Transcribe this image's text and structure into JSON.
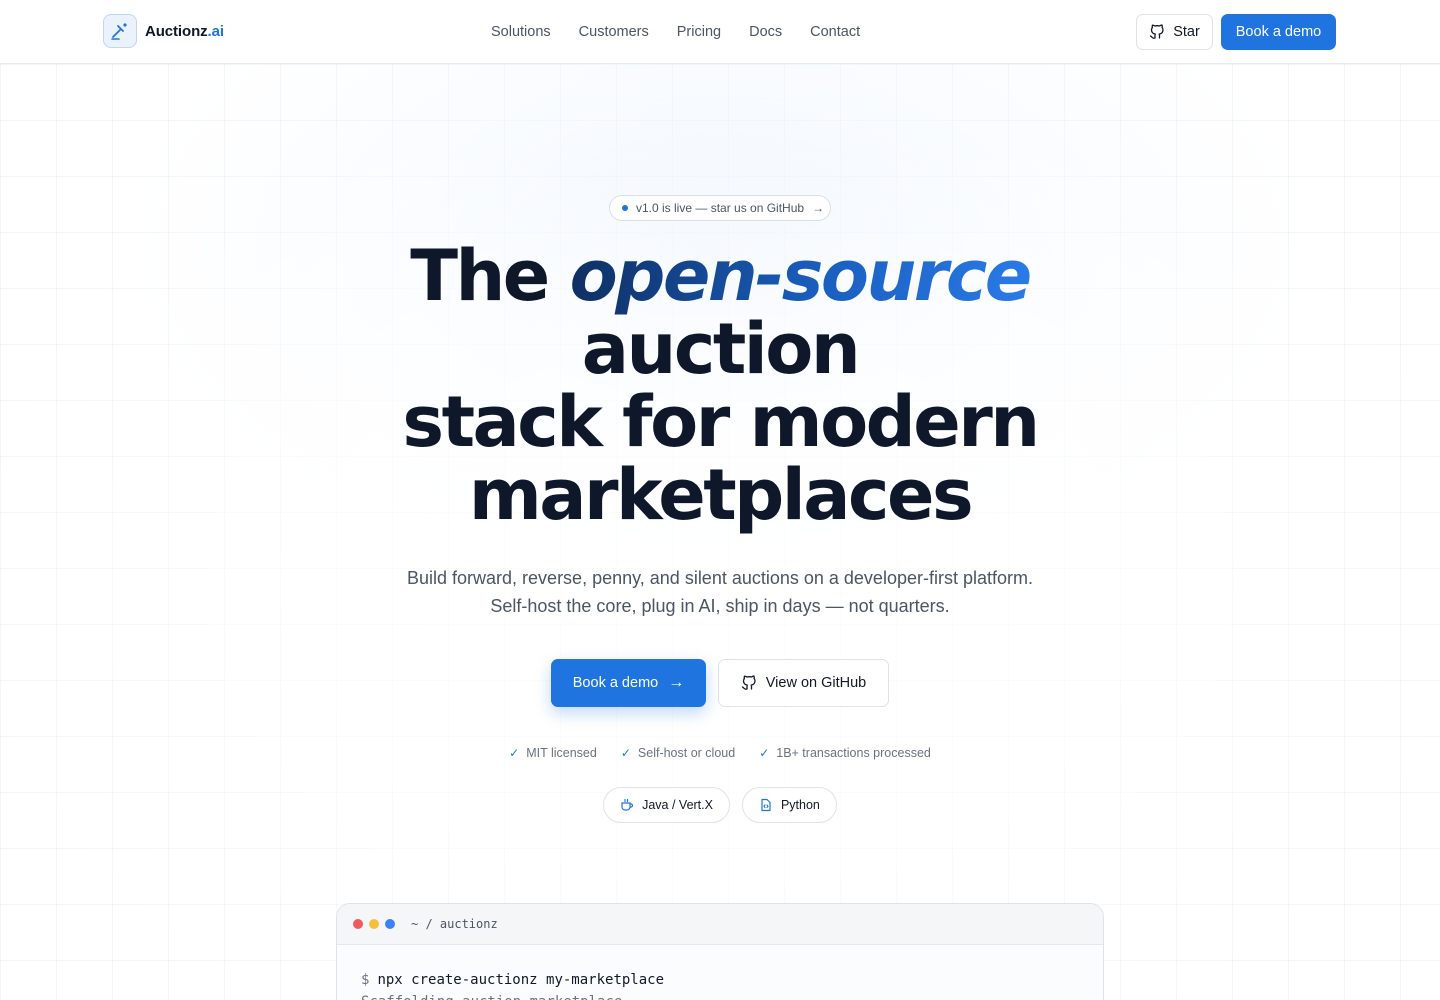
{
  "nav": {
    "brand_name": "Auctionz",
    "brand_tld": ".ai",
    "links": [
      "Solutions",
      "Customers",
      "Pricing",
      "Docs",
      "Contact"
    ],
    "star_label": "Star",
    "demo_label": "Book a demo"
  },
  "hero": {
    "badge": "v1.0 is live — star us on GitHub",
    "headline_prefix": "The",
    "headline_accent": "open-source",
    "headline_line2": "auction",
    "headline_line3": "stack for modern",
    "headline_line4": "marketplaces",
    "subtitle_line1": "Build forward, reverse, penny, and silent auctions on a developer-first platform.",
    "subtitle_line2": "Self-host the core, plug in AI, ship in days — not quarters.",
    "cta_primary": "Book a demo",
    "cta_secondary": "View on GitHub",
    "checks": [
      "MIT licensed",
      "Self-host or cloud",
      "1B+ transactions processed"
    ],
    "chips": [
      "Java / Vert.X",
      "Python"
    ]
  },
  "terminal": {
    "path": "~ / auctionz",
    "prompt": "$",
    "command": "npx create-auctionz my-marketplace",
    "output_partial": "Scaffolding auction marketplace..."
  },
  "colors": {
    "accent": "#1f74e0",
    "text": "#0f172a",
    "muted": "#4b5563",
    "dot_red": "#ef5b5b",
    "dot_yellow": "#f5bf3c",
    "dot_blue": "#3b82f6"
  }
}
